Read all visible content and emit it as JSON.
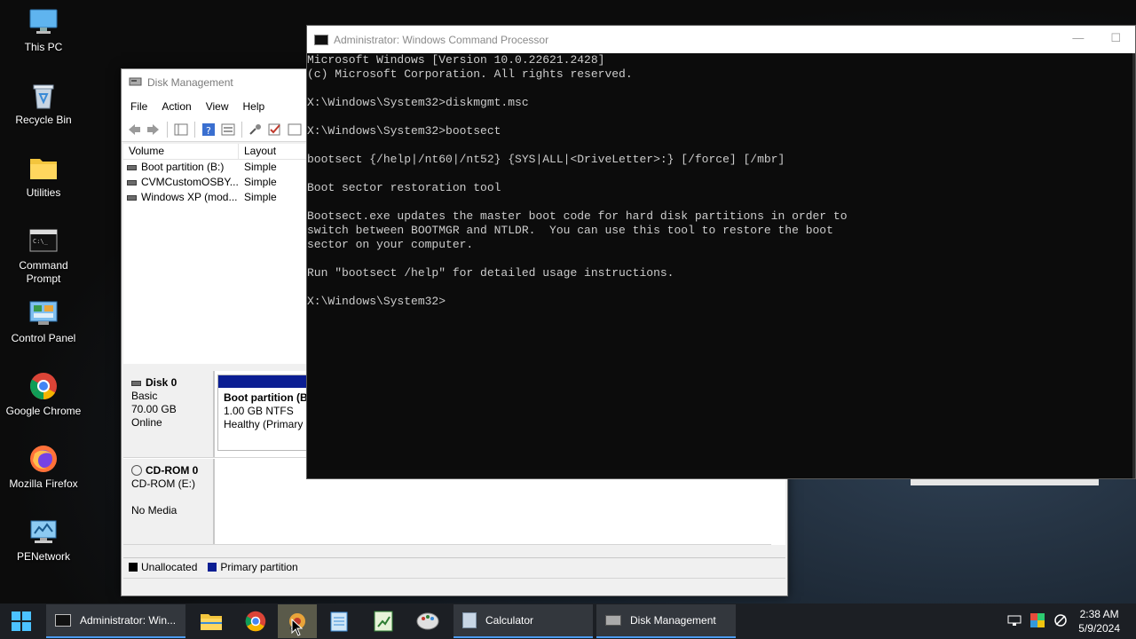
{
  "desktop": {
    "icons": [
      {
        "label": "This PC",
        "icon": "monitor-icon"
      },
      {
        "label": "Recycle Bin",
        "icon": "recycle-bin-icon"
      },
      {
        "label": "Utilities",
        "icon": "folder-icon"
      },
      {
        "label": "Command Prompt",
        "icon": "command-prompt-icon"
      },
      {
        "label": "Control Panel",
        "icon": "control-panel-icon"
      },
      {
        "label": "Google Chrome",
        "icon": "chrome-icon"
      },
      {
        "label": "Mozilla Firefox",
        "icon": "firefox-icon"
      },
      {
        "label": "PENetwork",
        "icon": "network-icon"
      }
    ]
  },
  "disk_management": {
    "title": "Disk Management",
    "menu": [
      "File",
      "Action",
      "View",
      "Help"
    ],
    "columns": [
      "Volume",
      "Layout"
    ],
    "volumes": [
      {
        "name": "Boot partition (B:)",
        "layout": "Simple"
      },
      {
        "name": "CVMCustomOSBY...",
        "layout": "Simple"
      },
      {
        "name": "Windows XP (mod...",
        "layout": "Simple"
      }
    ],
    "disks": [
      {
        "name": "Disk 0",
        "type": "Basic",
        "size": "70.00 GB",
        "status": "Online",
        "partition": {
          "name": "Boot partition  (B",
          "fs": "1.00 GB NTFS",
          "health": "Healthy (Primary P"
        }
      },
      {
        "name": "CD-ROM 0",
        "type": "CD-ROM (E:)",
        "status": "No Media"
      }
    ],
    "legend": [
      {
        "label": "Unallocated",
        "color": "#000000"
      },
      {
        "label": "Primary partition",
        "color": "#0b1e93"
      }
    ]
  },
  "cmd": {
    "title": "Administrator: Windows Command Processor",
    "lines": [
      "Microsoft Windows [Version 10.0.22621.2428]",
      "(c) Microsoft Corporation. All rights reserved.",
      "",
      "X:\\Windows\\System32>diskmgmt.msc",
      "",
      "X:\\Windows\\System32>bootsect",
      "",
      "bootsect {/help|/nt60|/nt52} {SYS|ALL|<DriveLetter>:} [/force] [/mbr]",
      "",
      "Boot sector restoration tool",
      "",
      "Bootsect.exe updates the master boot code for hard disk partitions in order to",
      "switch between BOOTMGR and NTLDR.  You can use this tool to restore the boot",
      "sector on your computer.",
      "",
      "Run \"bootsect /help\" for detailed usage instructions.",
      "",
      "X:\\Windows\\System32>"
    ]
  },
  "taskbar": {
    "items": [
      {
        "label": "Administrator: Win...",
        "icon": "cmd-icon"
      },
      {
        "label": "Calculator",
        "icon": "calculator-icon"
      },
      {
        "label": "Disk Management",
        "icon": "disk-management-icon"
      }
    ],
    "pinned": [
      "file-explorer-icon",
      "chrome-icon",
      "gear-tool-icon",
      "notepad-icon",
      "spreadsheet-icon",
      "paint-icon"
    ],
    "clock": {
      "time": "2:38 AM",
      "date": "5/9/2024"
    }
  }
}
